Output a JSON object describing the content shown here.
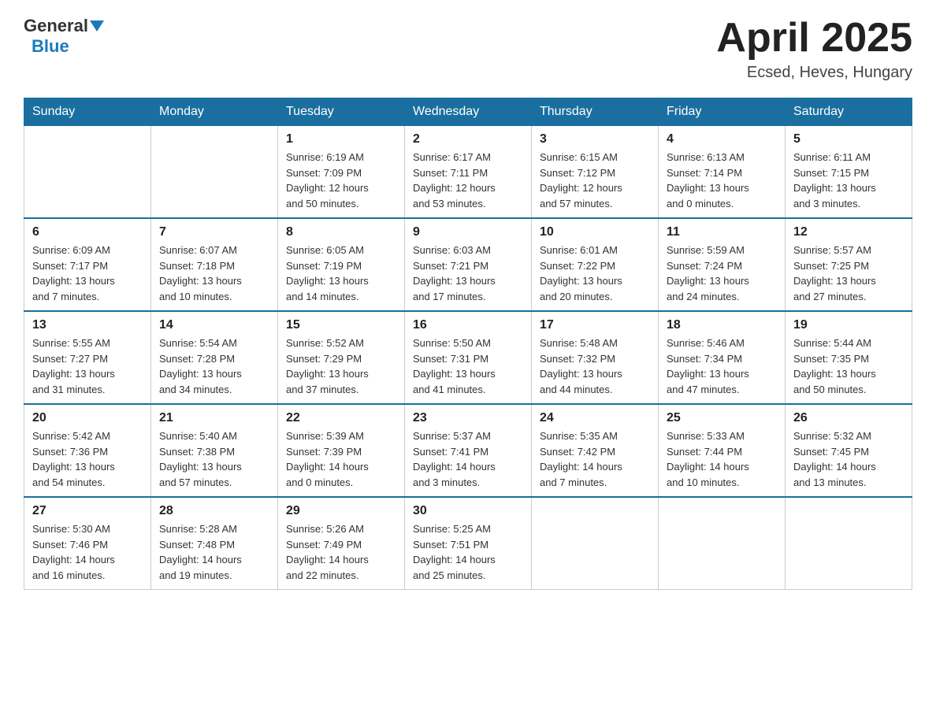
{
  "header": {
    "logo": {
      "general": "General",
      "blue": "Blue",
      "tagline": "GeneralBlue"
    },
    "title": "April 2025",
    "location": "Ecsed, Heves, Hungary"
  },
  "days_of_week": [
    "Sunday",
    "Monday",
    "Tuesday",
    "Wednesday",
    "Thursday",
    "Friday",
    "Saturday"
  ],
  "weeks": [
    [
      {
        "day": "",
        "info": ""
      },
      {
        "day": "",
        "info": ""
      },
      {
        "day": "1",
        "info": "Sunrise: 6:19 AM\nSunset: 7:09 PM\nDaylight: 12 hours\nand 50 minutes."
      },
      {
        "day": "2",
        "info": "Sunrise: 6:17 AM\nSunset: 7:11 PM\nDaylight: 12 hours\nand 53 minutes."
      },
      {
        "day": "3",
        "info": "Sunrise: 6:15 AM\nSunset: 7:12 PM\nDaylight: 12 hours\nand 57 minutes."
      },
      {
        "day": "4",
        "info": "Sunrise: 6:13 AM\nSunset: 7:14 PM\nDaylight: 13 hours\nand 0 minutes."
      },
      {
        "day": "5",
        "info": "Sunrise: 6:11 AM\nSunset: 7:15 PM\nDaylight: 13 hours\nand 3 minutes."
      }
    ],
    [
      {
        "day": "6",
        "info": "Sunrise: 6:09 AM\nSunset: 7:17 PM\nDaylight: 13 hours\nand 7 minutes."
      },
      {
        "day": "7",
        "info": "Sunrise: 6:07 AM\nSunset: 7:18 PM\nDaylight: 13 hours\nand 10 minutes."
      },
      {
        "day": "8",
        "info": "Sunrise: 6:05 AM\nSunset: 7:19 PM\nDaylight: 13 hours\nand 14 minutes."
      },
      {
        "day": "9",
        "info": "Sunrise: 6:03 AM\nSunset: 7:21 PM\nDaylight: 13 hours\nand 17 minutes."
      },
      {
        "day": "10",
        "info": "Sunrise: 6:01 AM\nSunset: 7:22 PM\nDaylight: 13 hours\nand 20 minutes."
      },
      {
        "day": "11",
        "info": "Sunrise: 5:59 AM\nSunset: 7:24 PM\nDaylight: 13 hours\nand 24 minutes."
      },
      {
        "day": "12",
        "info": "Sunrise: 5:57 AM\nSunset: 7:25 PM\nDaylight: 13 hours\nand 27 minutes."
      }
    ],
    [
      {
        "day": "13",
        "info": "Sunrise: 5:55 AM\nSunset: 7:27 PM\nDaylight: 13 hours\nand 31 minutes."
      },
      {
        "day": "14",
        "info": "Sunrise: 5:54 AM\nSunset: 7:28 PM\nDaylight: 13 hours\nand 34 minutes."
      },
      {
        "day": "15",
        "info": "Sunrise: 5:52 AM\nSunset: 7:29 PM\nDaylight: 13 hours\nand 37 minutes."
      },
      {
        "day": "16",
        "info": "Sunrise: 5:50 AM\nSunset: 7:31 PM\nDaylight: 13 hours\nand 41 minutes."
      },
      {
        "day": "17",
        "info": "Sunrise: 5:48 AM\nSunset: 7:32 PM\nDaylight: 13 hours\nand 44 minutes."
      },
      {
        "day": "18",
        "info": "Sunrise: 5:46 AM\nSunset: 7:34 PM\nDaylight: 13 hours\nand 47 minutes."
      },
      {
        "day": "19",
        "info": "Sunrise: 5:44 AM\nSunset: 7:35 PM\nDaylight: 13 hours\nand 50 minutes."
      }
    ],
    [
      {
        "day": "20",
        "info": "Sunrise: 5:42 AM\nSunset: 7:36 PM\nDaylight: 13 hours\nand 54 minutes."
      },
      {
        "day": "21",
        "info": "Sunrise: 5:40 AM\nSunset: 7:38 PM\nDaylight: 13 hours\nand 57 minutes."
      },
      {
        "day": "22",
        "info": "Sunrise: 5:39 AM\nSunset: 7:39 PM\nDaylight: 14 hours\nand 0 minutes."
      },
      {
        "day": "23",
        "info": "Sunrise: 5:37 AM\nSunset: 7:41 PM\nDaylight: 14 hours\nand 3 minutes."
      },
      {
        "day": "24",
        "info": "Sunrise: 5:35 AM\nSunset: 7:42 PM\nDaylight: 14 hours\nand 7 minutes."
      },
      {
        "day": "25",
        "info": "Sunrise: 5:33 AM\nSunset: 7:44 PM\nDaylight: 14 hours\nand 10 minutes."
      },
      {
        "day": "26",
        "info": "Sunrise: 5:32 AM\nSunset: 7:45 PM\nDaylight: 14 hours\nand 13 minutes."
      }
    ],
    [
      {
        "day": "27",
        "info": "Sunrise: 5:30 AM\nSunset: 7:46 PM\nDaylight: 14 hours\nand 16 minutes."
      },
      {
        "day": "28",
        "info": "Sunrise: 5:28 AM\nSunset: 7:48 PM\nDaylight: 14 hours\nand 19 minutes."
      },
      {
        "day": "29",
        "info": "Sunrise: 5:26 AM\nSunset: 7:49 PM\nDaylight: 14 hours\nand 22 minutes."
      },
      {
        "day": "30",
        "info": "Sunrise: 5:25 AM\nSunset: 7:51 PM\nDaylight: 14 hours\nand 25 minutes."
      },
      {
        "day": "",
        "info": ""
      },
      {
        "day": "",
        "info": ""
      },
      {
        "day": "",
        "info": ""
      }
    ]
  ]
}
